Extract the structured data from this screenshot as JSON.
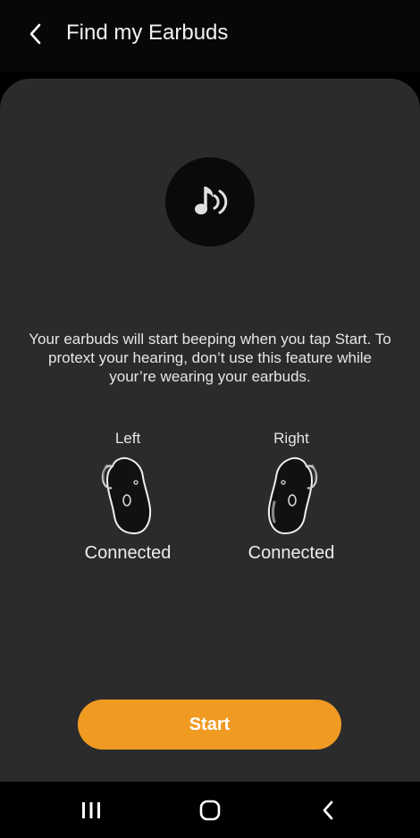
{
  "header": {
    "title": "Find my Earbuds",
    "back_icon": "chevron-left-icon"
  },
  "sound_icon": "music-note-sound-icon",
  "description": "Your earbuds will start beeping when you tap Start. To protext your hearing, don’t use this feature while your’re wearing your earbuds.",
  "earbuds": {
    "left": {
      "label": "Left",
      "status": "Connected",
      "icon": "left-earbud-icon"
    },
    "right": {
      "label": "Right",
      "status": "Connected",
      "icon": "right-earbud-icon"
    }
  },
  "start_button": {
    "label": "Start",
    "color": "#f09a22"
  },
  "nav_bar": {
    "recents_icon": "recents-icon",
    "home_icon": "home-icon",
    "back_icon": "back-icon"
  },
  "colors": {
    "background": "#000000",
    "card": "#2b2b2b",
    "accent": "#f09a22"
  }
}
